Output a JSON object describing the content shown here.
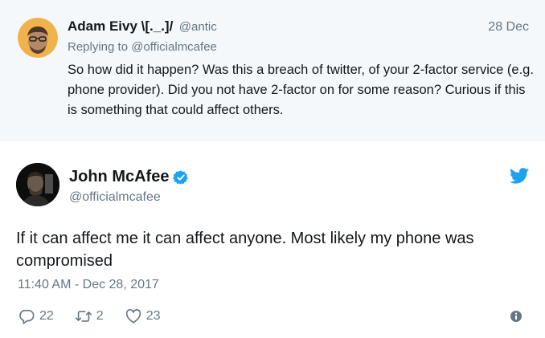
{
  "reply": {
    "name": "Adam Eivy \\[._.]/",
    "handle": "@antic",
    "date": "28 Dec",
    "replying_label": "Replying to",
    "replying_to": "@officialmcafee",
    "text": "So how did it happen? Was this a breach of twitter, of your 2-factor service (e.g. phone provider). Did you not have 2-factor on for some reason? Curious if this is something that could affect others."
  },
  "tweet": {
    "name": "John McAfee",
    "handle": "@officialmcafee",
    "text": "If it can affect me it can affect anyone. Most likely my phone was compromised",
    "timestamp": "11:40 AM - Dec 28, 2017",
    "replies": "22",
    "retweets": "2",
    "likes": "23"
  },
  "icons": {
    "verified": "verified-badge-icon",
    "brand": "twitter-bird-icon",
    "reply": "reply-bubble-icon",
    "retweet": "retweet-icon",
    "like": "heart-icon",
    "info": "info-icon"
  },
  "colors": {
    "brand_blue": "#1da1f2",
    "muted_text": "#657786",
    "reply_background": "#f5f8fa"
  }
}
